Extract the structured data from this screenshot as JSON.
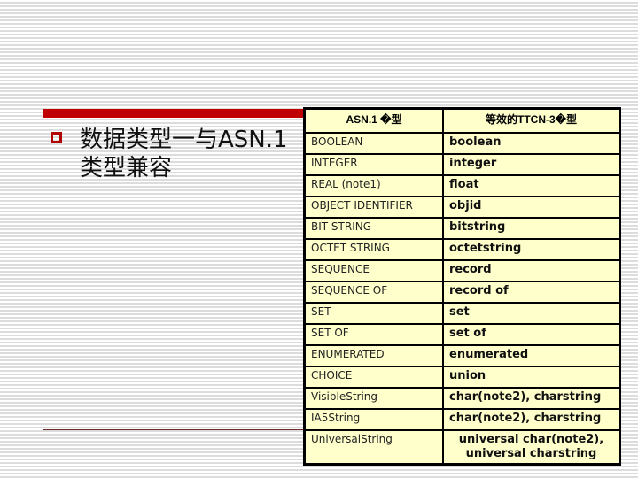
{
  "bullet": {
    "text": "数据类型一与ASN.1类型兼容",
    "line1": "数据类型一与ASN.1",
    "line2": "类型兼容"
  },
  "colors": {
    "accent": "#c00000",
    "table_bg": "#ffffcc"
  },
  "table": {
    "headers": [
      "ASN.1 �型",
      "等效的TTCN-3�型"
    ],
    "rows": [
      [
        "BOOLEAN",
        "boolean"
      ],
      [
        "INTEGER",
        "integer"
      ],
      [
        "REAL (note1)",
        "float"
      ],
      [
        "OBJECT IDENTIFIER",
        "objid"
      ],
      [
        "BIT STRING",
        "bitstring"
      ],
      [
        "OCTET STRING",
        "octetstring"
      ],
      [
        "SEQUENCE",
        "record"
      ],
      [
        "SEQUENCE OF",
        "record of"
      ],
      [
        "SET",
        "set"
      ],
      [
        "SET OF",
        "set of"
      ],
      [
        "ENUMERATED",
        "enumerated"
      ],
      [
        "CHOICE",
        "union"
      ],
      [
        "VisibleString",
        "char(note2), charstring"
      ],
      [
        "IA5String",
        "char(note2), charstring"
      ],
      [
        "UniversalString",
        "universal char(note2),\nuniversal charstring"
      ]
    ]
  }
}
